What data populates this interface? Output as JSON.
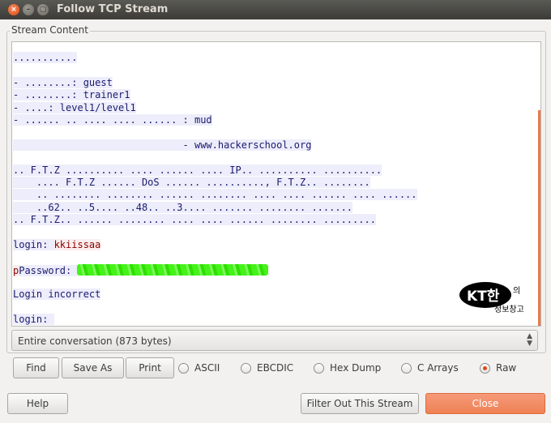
{
  "window": {
    "title": "Follow TCP Stream",
    "close_glyph": "×",
    "minimize_glyph": "–",
    "maximize_glyph": "▢"
  },
  "section_label": "Stream Content",
  "stream": {
    "lines": [
      {
        "text": "...........",
        "kind": "server"
      },
      {
        "text": "",
        "kind": "blank"
      },
      {
        "text": "- ........: guest",
        "kind": "server"
      },
      {
        "text": "- ........: trainer1",
        "kind": "server"
      },
      {
        "text": "- ....: level1/level1",
        "kind": "server"
      },
      {
        "text": "- ...... .. .... .... ...... : mud",
        "kind": "server"
      },
      {
        "text": "",
        "kind": "blank"
      },
      {
        "text": "                             - www.hackerschool.org",
        "kind": "server"
      },
      {
        "text": "",
        "kind": "blank"
      },
      {
        "text": ".. F.T.Z .......... .... ...... .... IP.. .......... ..........",
        "kind": "server"
      },
      {
        "text": "    .... F.T.Z ...... DoS ...... .........., F.T.Z.. ........",
        "kind": "server"
      },
      {
        "text": "    .. ........ ........ ...... ........ .... .... ...... .... ......",
        "kind": "server"
      },
      {
        "text": "    ..62.. ..5.... ..48.. ..3.... ....... ........ .......",
        "kind": "server"
      },
      {
        "text": ".. F.T.Z.. ...... ........ .... .... ...... ........ .........",
        "kind": "server"
      },
      {
        "text": "",
        "kind": "blank"
      },
      {
        "text": "login: kkiissaa",
        "kind": "login"
      },
      {
        "text": "",
        "kind": "blank"
      },
      {
        "text": "pPassword: ",
        "kind": "password"
      },
      {
        "text": "",
        "kind": "blank"
      },
      {
        "text": "Login incorrect",
        "kind": "server"
      },
      {
        "text": "",
        "kind": "blank"
      },
      {
        "text": "login: ",
        "kind": "server"
      }
    ],
    "login_prompt": "login: ",
    "login_value": "kkiissaa",
    "password_client_char": "p",
    "password_prompt": "Password: "
  },
  "watermark": {
    "logo_text": "KT한",
    "suffix": "의",
    "subtitle": "정보창고"
  },
  "conversation_select": {
    "selected": "Entire conversation (873 bytes)",
    "arrow_up": "▲",
    "arrow_down": "▼"
  },
  "buttons": {
    "find": "Find",
    "save_as": "Save As",
    "print": "Print",
    "help": "Help",
    "filter_out": "Filter Out This Stream",
    "close": "Close"
  },
  "formats": [
    {
      "label": "ASCII",
      "checked": false
    },
    {
      "label": "EBCDIC",
      "checked": false
    },
    {
      "label": "Hex Dump",
      "checked": false
    },
    {
      "label": "C Arrays",
      "checked": false
    },
    {
      "label": "Raw",
      "checked": true
    }
  ],
  "colors": {
    "accent": "#ef8254",
    "server_text": "#1a1a6e",
    "client_text": "#8b0000",
    "redaction": "#45f21a"
  }
}
